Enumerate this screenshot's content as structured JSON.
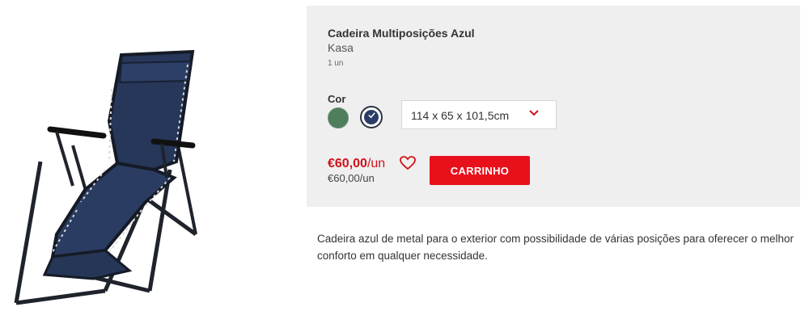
{
  "product": {
    "title": "Cadeira Multiposições Azul",
    "brand": "Kasa",
    "quantity": "1 un",
    "color_label": "Cor",
    "colors": [
      {
        "name": "green",
        "hex": "#4f7e5c",
        "selected": false
      },
      {
        "name": "blue",
        "hex": "#2a3d66",
        "selected": true
      }
    ],
    "size_selected": "114 x 65 x 101,5cm",
    "price": "€60,00",
    "price_unit": "/un",
    "unit_price": "€60,00/un",
    "cart_button_label": "CARRINHO",
    "description": "Cadeira azul de metal para o exterior com possibilidade de várias posições para oferecer o melhor conforto em qualquer necessidade."
  },
  "icons": {
    "favorite": "heart-icon",
    "dropdown": "chevron-down-icon",
    "selected": "check-icon"
  },
  "colors": {
    "accent": "#e8101b",
    "price": "#d0121b",
    "panel_bg": "#efefef"
  }
}
